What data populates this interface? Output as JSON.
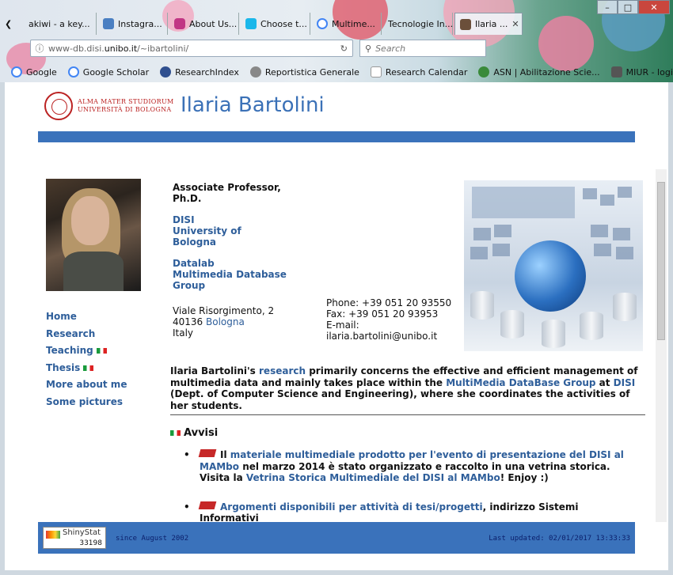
{
  "browser": {
    "tabs": [
      {
        "title": "akiwi - a key..."
      },
      {
        "title": "Instagra..."
      },
      {
        "title": "About Us..."
      },
      {
        "title": "Choose t..."
      },
      {
        "title": "Multime..."
      },
      {
        "title": "Tecnologie In..."
      },
      {
        "title": "Ilaria ...",
        "active": true
      }
    ],
    "url_prefix": "www-db.disi.",
    "url_host": "unibo.it",
    "url_path": "/~ibartolini/",
    "search_placeholder": "Search",
    "bookmarks": [
      "Google",
      "Google Scholar",
      "ResearchIndex",
      "Reportistica Generale",
      "Research Calendar",
      "ASN | Abilitazione Scie...",
      "MIUR - login:miur.cine..."
    ]
  },
  "page": {
    "logo_line1": "ALMA MATER STUDIORUM",
    "logo_line2": "UNIVERSITÀ DI BOLOGNA",
    "title": "Ilaria Bartolini",
    "nav": [
      {
        "label": "Home"
      },
      {
        "label": "Research"
      },
      {
        "label": "Teaching"
      },
      {
        "label": "Thesis"
      },
      {
        "label": "More about me"
      },
      {
        "label": "Some pictures"
      }
    ],
    "role_line1": "Associate Professor,",
    "role_line2": "Ph.D.",
    "dept_line1": "DISI",
    "dept_line2": "University of",
    "dept_line3": "Bologna",
    "group_line1": "Datalab",
    "group_line2": "Multimedia Database",
    "group_line3": "Group",
    "addr_line1": "Viale Risorgimento, 2",
    "addr_zip": "40136",
    "addr_city": "Bologna",
    "addr_country": "Italy",
    "phone": "Phone: +39 051 20 93550",
    "fax": "Fax: +39 051 20 93953",
    "email_label": "E-mail:",
    "email": "ilaria.bartolini@unibo.it",
    "intro": {
      "p1": "Ilaria Bartolini's ",
      "link1": "research",
      "p2": " primarily concerns the effective and efficient management of multimedia data and mainly takes place within the ",
      "link2": "MultiMedia DataBase Group",
      "p3": " at ",
      "link3": "DISI",
      "p4": " (Dept. of Computer Science and Engineering), where she coordinates the activities of her students."
    },
    "avvisi_title": "Avvisi",
    "news1": {
      "t1": "Il ",
      "link1": "materiale multimediale prodotto per l'evento di presentazione del DISI al MAMbo",
      "t2": " nel marzo 2014 è stato organizzato e raccolto in una vetrina storica. Visita la ",
      "link2": "Vetrina Storica Multimediale del DISI al MAMbo",
      "t3": "! Enjoy :)"
    },
    "news2": {
      "link1": "Argomenti disponibili per attività di tesi/progetti",
      "t1": ", indirizzo Sistemi Informativi"
    },
    "counter_name": "ShinyStat",
    "counter_value": "33198",
    "since": "since August 2002",
    "updated": "Last updated: 02/01/2017 13:33:33"
  }
}
